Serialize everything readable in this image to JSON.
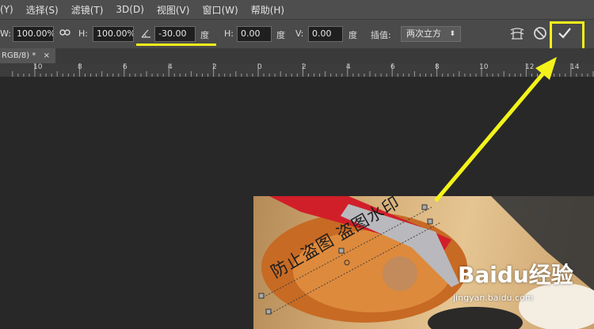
{
  "menubar": {
    "items": [
      "(Y)",
      "选择(S)",
      "滤镜(T)",
      "3D(D)",
      "视图(V)",
      "窗口(W)",
      "帮助(H)"
    ]
  },
  "options": {
    "w_label": "W:",
    "w_value": "100.00%",
    "h_label": "H:",
    "h_value": "100.00%",
    "angle_value": "-30.00",
    "angle_unit": "度",
    "hskew_label": "H:",
    "hskew_value": "0.00",
    "hskew_unit": "度",
    "vskew_label": "V:",
    "vskew_value": "0.00",
    "vskew_unit": "度",
    "interp_label": "插值:",
    "interp_value": "两次立方"
  },
  "document_tab": {
    "label": "RGB/8) *",
    "close": "×"
  },
  "ruler": {
    "labels": [
      "10",
      "8",
      "6",
      "4",
      "2",
      "0",
      "2",
      "4",
      "6",
      "8",
      "10",
      "12",
      "14"
    ]
  },
  "image": {
    "watermark_text": "防止盗图 盗图水印",
    "brand": "Baidu经验",
    "url": "jingyan.baidu.com"
  },
  "colors": {
    "highlight": "#f3f31a",
    "menubar": "#4e4e4e",
    "optionsbar": "#4a4a4a",
    "canvas": "#282828"
  }
}
